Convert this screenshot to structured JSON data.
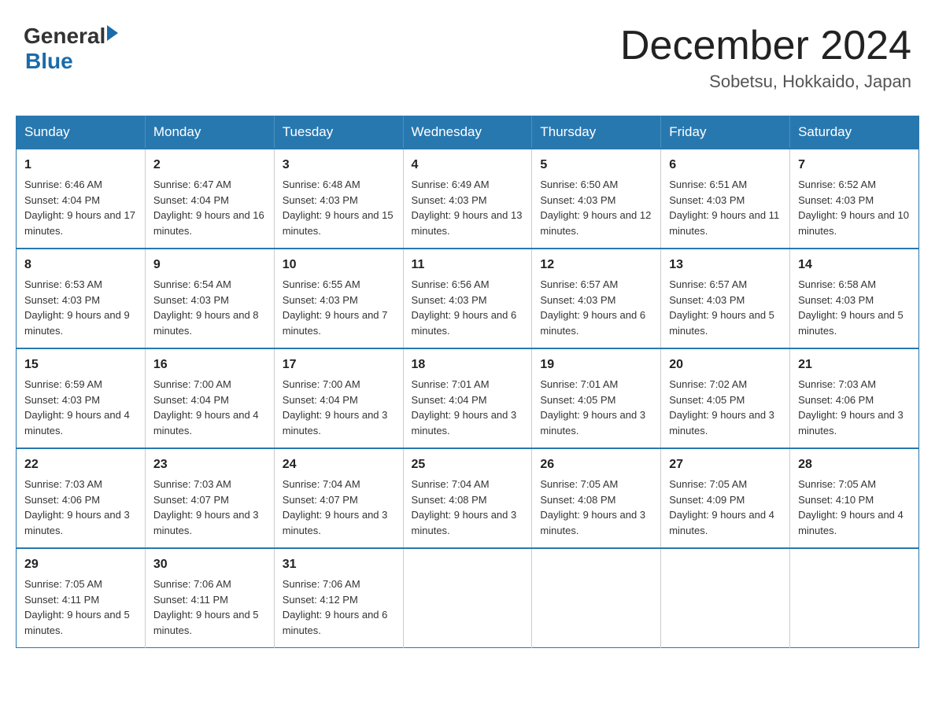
{
  "logo": {
    "general": "General",
    "arrow": "▶",
    "blue": "Blue"
  },
  "title": "December 2024",
  "location": "Sobetsu, Hokkaido, Japan",
  "days_of_week": [
    "Sunday",
    "Monday",
    "Tuesday",
    "Wednesday",
    "Thursday",
    "Friday",
    "Saturday"
  ],
  "weeks": [
    [
      {
        "day": "1",
        "sunrise": "Sunrise: 6:46 AM",
        "sunset": "Sunset: 4:04 PM",
        "daylight": "Daylight: 9 hours and 17 minutes."
      },
      {
        "day": "2",
        "sunrise": "Sunrise: 6:47 AM",
        "sunset": "Sunset: 4:04 PM",
        "daylight": "Daylight: 9 hours and 16 minutes."
      },
      {
        "day": "3",
        "sunrise": "Sunrise: 6:48 AM",
        "sunset": "Sunset: 4:03 PM",
        "daylight": "Daylight: 9 hours and 15 minutes."
      },
      {
        "day": "4",
        "sunrise": "Sunrise: 6:49 AM",
        "sunset": "Sunset: 4:03 PM",
        "daylight": "Daylight: 9 hours and 13 minutes."
      },
      {
        "day": "5",
        "sunrise": "Sunrise: 6:50 AM",
        "sunset": "Sunset: 4:03 PM",
        "daylight": "Daylight: 9 hours and 12 minutes."
      },
      {
        "day": "6",
        "sunrise": "Sunrise: 6:51 AM",
        "sunset": "Sunset: 4:03 PM",
        "daylight": "Daylight: 9 hours and 11 minutes."
      },
      {
        "day": "7",
        "sunrise": "Sunrise: 6:52 AM",
        "sunset": "Sunset: 4:03 PM",
        "daylight": "Daylight: 9 hours and 10 minutes."
      }
    ],
    [
      {
        "day": "8",
        "sunrise": "Sunrise: 6:53 AM",
        "sunset": "Sunset: 4:03 PM",
        "daylight": "Daylight: 9 hours and 9 minutes."
      },
      {
        "day": "9",
        "sunrise": "Sunrise: 6:54 AM",
        "sunset": "Sunset: 4:03 PM",
        "daylight": "Daylight: 9 hours and 8 minutes."
      },
      {
        "day": "10",
        "sunrise": "Sunrise: 6:55 AM",
        "sunset": "Sunset: 4:03 PM",
        "daylight": "Daylight: 9 hours and 7 minutes."
      },
      {
        "day": "11",
        "sunrise": "Sunrise: 6:56 AM",
        "sunset": "Sunset: 4:03 PM",
        "daylight": "Daylight: 9 hours and 6 minutes."
      },
      {
        "day": "12",
        "sunrise": "Sunrise: 6:57 AM",
        "sunset": "Sunset: 4:03 PM",
        "daylight": "Daylight: 9 hours and 6 minutes."
      },
      {
        "day": "13",
        "sunrise": "Sunrise: 6:57 AM",
        "sunset": "Sunset: 4:03 PM",
        "daylight": "Daylight: 9 hours and 5 minutes."
      },
      {
        "day": "14",
        "sunrise": "Sunrise: 6:58 AM",
        "sunset": "Sunset: 4:03 PM",
        "daylight": "Daylight: 9 hours and 5 minutes."
      }
    ],
    [
      {
        "day": "15",
        "sunrise": "Sunrise: 6:59 AM",
        "sunset": "Sunset: 4:03 PM",
        "daylight": "Daylight: 9 hours and 4 minutes."
      },
      {
        "day": "16",
        "sunrise": "Sunrise: 7:00 AM",
        "sunset": "Sunset: 4:04 PM",
        "daylight": "Daylight: 9 hours and 4 minutes."
      },
      {
        "day": "17",
        "sunrise": "Sunrise: 7:00 AM",
        "sunset": "Sunset: 4:04 PM",
        "daylight": "Daylight: 9 hours and 3 minutes."
      },
      {
        "day": "18",
        "sunrise": "Sunrise: 7:01 AM",
        "sunset": "Sunset: 4:04 PM",
        "daylight": "Daylight: 9 hours and 3 minutes."
      },
      {
        "day": "19",
        "sunrise": "Sunrise: 7:01 AM",
        "sunset": "Sunset: 4:05 PM",
        "daylight": "Daylight: 9 hours and 3 minutes."
      },
      {
        "day": "20",
        "sunrise": "Sunrise: 7:02 AM",
        "sunset": "Sunset: 4:05 PM",
        "daylight": "Daylight: 9 hours and 3 minutes."
      },
      {
        "day": "21",
        "sunrise": "Sunrise: 7:03 AM",
        "sunset": "Sunset: 4:06 PM",
        "daylight": "Daylight: 9 hours and 3 minutes."
      }
    ],
    [
      {
        "day": "22",
        "sunrise": "Sunrise: 7:03 AM",
        "sunset": "Sunset: 4:06 PM",
        "daylight": "Daylight: 9 hours and 3 minutes."
      },
      {
        "day": "23",
        "sunrise": "Sunrise: 7:03 AM",
        "sunset": "Sunset: 4:07 PM",
        "daylight": "Daylight: 9 hours and 3 minutes."
      },
      {
        "day": "24",
        "sunrise": "Sunrise: 7:04 AM",
        "sunset": "Sunset: 4:07 PM",
        "daylight": "Daylight: 9 hours and 3 minutes."
      },
      {
        "day": "25",
        "sunrise": "Sunrise: 7:04 AM",
        "sunset": "Sunset: 4:08 PM",
        "daylight": "Daylight: 9 hours and 3 minutes."
      },
      {
        "day": "26",
        "sunrise": "Sunrise: 7:05 AM",
        "sunset": "Sunset: 4:08 PM",
        "daylight": "Daylight: 9 hours and 3 minutes."
      },
      {
        "day": "27",
        "sunrise": "Sunrise: 7:05 AM",
        "sunset": "Sunset: 4:09 PM",
        "daylight": "Daylight: 9 hours and 4 minutes."
      },
      {
        "day": "28",
        "sunrise": "Sunrise: 7:05 AM",
        "sunset": "Sunset: 4:10 PM",
        "daylight": "Daylight: 9 hours and 4 minutes."
      }
    ],
    [
      {
        "day": "29",
        "sunrise": "Sunrise: 7:05 AM",
        "sunset": "Sunset: 4:11 PM",
        "daylight": "Daylight: 9 hours and 5 minutes."
      },
      {
        "day": "30",
        "sunrise": "Sunrise: 7:06 AM",
        "sunset": "Sunset: 4:11 PM",
        "daylight": "Daylight: 9 hours and 5 minutes."
      },
      {
        "day": "31",
        "sunrise": "Sunrise: 7:06 AM",
        "sunset": "Sunset: 4:12 PM",
        "daylight": "Daylight: 9 hours and 6 minutes."
      },
      null,
      null,
      null,
      null
    ]
  ]
}
